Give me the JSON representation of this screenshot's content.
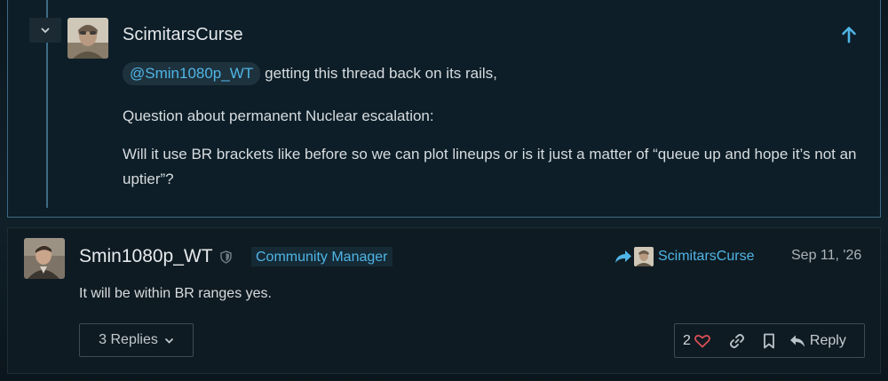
{
  "quoted_post": {
    "username": "ScimitarsCurse",
    "mention": "@Smin1080p_WT",
    "line1_rest": "getting this thread back on its rails,",
    "paragraph2": "Question about permanent Nuclear escalation:",
    "paragraph3": "Will it use BR brackets like before so we can plot lineups or is it just a matter of “queue up and hope it’s not an uptier”?",
    "icons": [
      "chevron-down-icon",
      "arrow-up-icon"
    ]
  },
  "reply_post": {
    "username": "Smin1080p_WT",
    "flair": "Community Manager",
    "reply_to_name": "ScimitarsCurse",
    "date": "Sep 11, '26",
    "body": "It will be within BR ranges yes.",
    "replies_label": "3 Replies",
    "like_count": "2",
    "reply_label": "Reply",
    "icons": [
      "shield-icon",
      "share-arrow-icon",
      "heart-icon",
      "link-icon",
      "bookmark-icon",
      "reply-icon"
    ]
  },
  "colors": {
    "accent": "#4fb5e6",
    "like": "#e0505a",
    "border_highlight": "#3d6a85"
  }
}
